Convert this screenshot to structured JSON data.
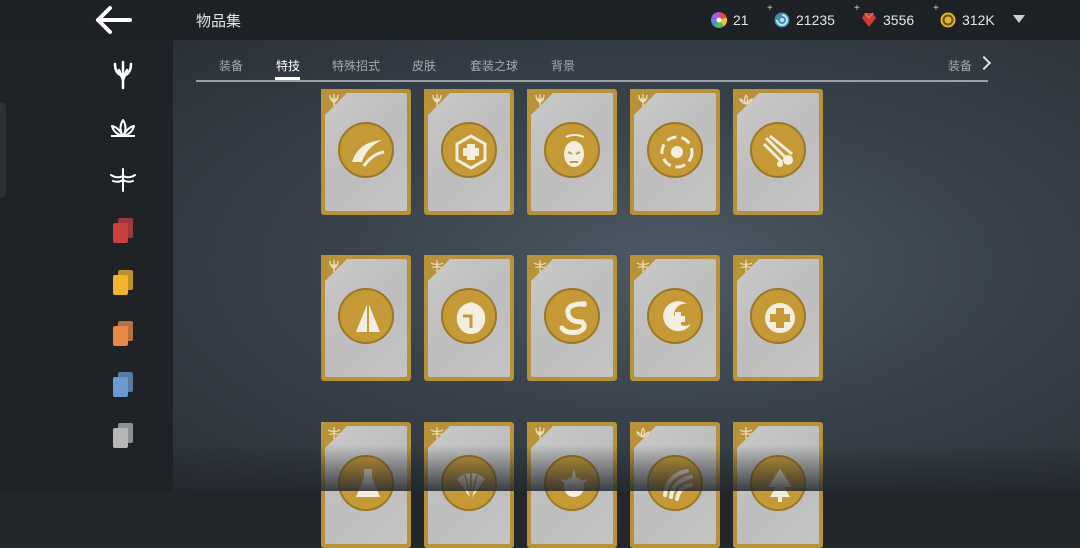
{
  "header": {
    "title": "物品集",
    "currencies": [
      {
        "name": "multicolor",
        "value": "21",
        "plus": false
      },
      {
        "name": "swirl",
        "value": "21235",
        "plus": true
      },
      {
        "name": "gem",
        "value": "3556",
        "plus": true
      },
      {
        "name": "coin",
        "value": "312K",
        "plus": true
      }
    ]
  },
  "tabs": [
    {
      "label": "装备",
      "active": false
    },
    {
      "label": "特技",
      "active": true
    },
    {
      "label": "特殊招式",
      "active": false
    },
    {
      "label": "皮肤",
      "active": false
    },
    {
      "label": "套装之球",
      "active": false
    },
    {
      "label": "背景",
      "active": false
    }
  ],
  "tab_more_label": "装备",
  "sidebar": [
    {
      "icon": "trident-icon"
    },
    {
      "icon": "lotus-icon"
    },
    {
      "icon": "dragonfly-icon"
    },
    {
      "icon": "red-cards-icon",
      "color": "#c9413d"
    },
    {
      "icon": "yellow-cards-icon",
      "color": "#f1b42a"
    },
    {
      "icon": "orange-cards-icon",
      "color": "#e58a47"
    },
    {
      "icon": "blue-cards-icon",
      "color": "#6b9ad0"
    },
    {
      "icon": "gray-cards-icon",
      "color": "#b6b6b6"
    }
  ],
  "cards": [
    {
      "corner": "trident-icon",
      "emblem": "slash-icon"
    },
    {
      "corner": "trident-icon",
      "emblem": "shield-cross-icon"
    },
    {
      "corner": "trident-icon",
      "emblem": "mask-icon"
    },
    {
      "corner": "trident-icon",
      "emblem": "vortex-icon"
    },
    {
      "corner": "lotus-icon",
      "emblem": "meteor-icon"
    },
    {
      "corner": "trident-icon",
      "emblem": "bell-icon"
    },
    {
      "corner": "dragonfly-icon",
      "emblem": "helmet-icon"
    },
    {
      "corner": "dragonfly-icon",
      "emblem": "serpent-icon"
    },
    {
      "corner": "dragonfly-icon",
      "emblem": "moon-cross-icon"
    },
    {
      "corner": "dragonfly-icon",
      "emblem": "heal-cross-icon"
    },
    {
      "corner": "dragonfly-icon",
      "emblem": "potion-icon"
    },
    {
      "corner": "dragonfly-icon",
      "emblem": "fan-icon"
    },
    {
      "corner": "trident-icon",
      "emblem": "spiked-icon"
    },
    {
      "corner": "lotus-icon",
      "emblem": "claw-icon"
    },
    {
      "corner": "dragonfly-icon",
      "emblem": "tree-icon"
    }
  ],
  "colors": {
    "card_gold": "#b89238",
    "emblem_gold": "#c59a36",
    "card_face": "#c4c4c4"
  }
}
